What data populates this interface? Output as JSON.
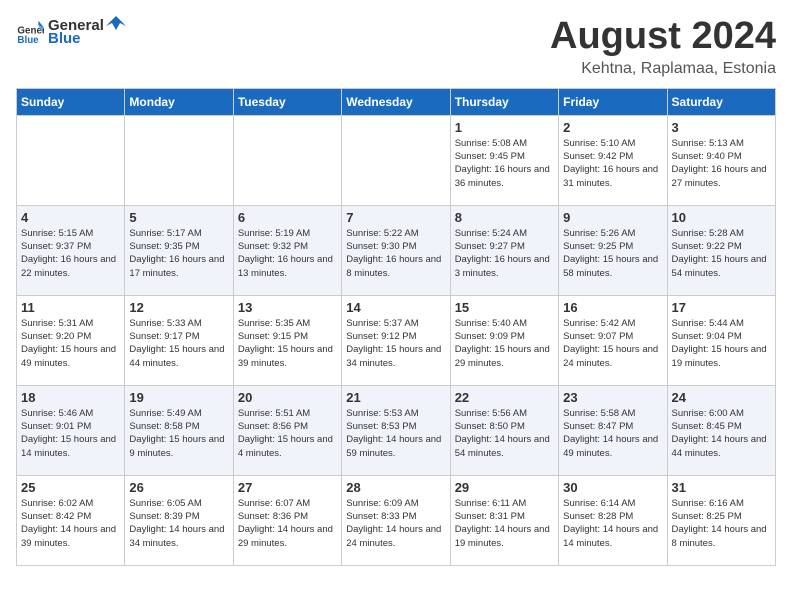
{
  "header": {
    "logo_general": "General",
    "logo_blue": "Blue",
    "title": "August 2024",
    "subtitle": "Kehtna, Raplamaa, Estonia"
  },
  "weekdays": [
    "Sunday",
    "Monday",
    "Tuesday",
    "Wednesday",
    "Thursday",
    "Friday",
    "Saturday"
  ],
  "weeks": [
    [
      {
        "day": "",
        "empty": true
      },
      {
        "day": "",
        "empty": true
      },
      {
        "day": "",
        "empty": true
      },
      {
        "day": "",
        "empty": true
      },
      {
        "day": "1",
        "sunrise": "5:08 AM",
        "sunset": "9:45 PM",
        "daylight": "16 hours and 36 minutes."
      },
      {
        "day": "2",
        "sunrise": "5:10 AM",
        "sunset": "9:42 PM",
        "daylight": "16 hours and 31 minutes."
      },
      {
        "day": "3",
        "sunrise": "5:13 AM",
        "sunset": "9:40 PM",
        "daylight": "16 hours and 27 minutes."
      }
    ],
    [
      {
        "day": "4",
        "sunrise": "5:15 AM",
        "sunset": "9:37 PM",
        "daylight": "16 hours and 22 minutes."
      },
      {
        "day": "5",
        "sunrise": "5:17 AM",
        "sunset": "9:35 PM",
        "daylight": "16 hours and 17 minutes."
      },
      {
        "day": "6",
        "sunrise": "5:19 AM",
        "sunset": "9:32 PM",
        "daylight": "16 hours and 13 minutes."
      },
      {
        "day": "7",
        "sunrise": "5:22 AM",
        "sunset": "9:30 PM",
        "daylight": "16 hours and 8 minutes."
      },
      {
        "day": "8",
        "sunrise": "5:24 AM",
        "sunset": "9:27 PM",
        "daylight": "16 hours and 3 minutes."
      },
      {
        "day": "9",
        "sunrise": "5:26 AM",
        "sunset": "9:25 PM",
        "daylight": "15 hours and 58 minutes."
      },
      {
        "day": "10",
        "sunrise": "5:28 AM",
        "sunset": "9:22 PM",
        "daylight": "15 hours and 54 minutes."
      }
    ],
    [
      {
        "day": "11",
        "sunrise": "5:31 AM",
        "sunset": "9:20 PM",
        "daylight": "15 hours and 49 minutes."
      },
      {
        "day": "12",
        "sunrise": "5:33 AM",
        "sunset": "9:17 PM",
        "daylight": "15 hours and 44 minutes."
      },
      {
        "day": "13",
        "sunrise": "5:35 AM",
        "sunset": "9:15 PM",
        "daylight": "15 hours and 39 minutes."
      },
      {
        "day": "14",
        "sunrise": "5:37 AM",
        "sunset": "9:12 PM",
        "daylight": "15 hours and 34 minutes."
      },
      {
        "day": "15",
        "sunrise": "5:40 AM",
        "sunset": "9:09 PM",
        "daylight": "15 hours and 29 minutes."
      },
      {
        "day": "16",
        "sunrise": "5:42 AM",
        "sunset": "9:07 PM",
        "daylight": "15 hours and 24 minutes."
      },
      {
        "day": "17",
        "sunrise": "5:44 AM",
        "sunset": "9:04 PM",
        "daylight": "15 hours and 19 minutes."
      }
    ],
    [
      {
        "day": "18",
        "sunrise": "5:46 AM",
        "sunset": "9:01 PM",
        "daylight": "15 hours and 14 minutes."
      },
      {
        "day": "19",
        "sunrise": "5:49 AM",
        "sunset": "8:58 PM",
        "daylight": "15 hours and 9 minutes."
      },
      {
        "day": "20",
        "sunrise": "5:51 AM",
        "sunset": "8:56 PM",
        "daylight": "15 hours and 4 minutes."
      },
      {
        "day": "21",
        "sunrise": "5:53 AM",
        "sunset": "8:53 PM",
        "daylight": "14 hours and 59 minutes."
      },
      {
        "day": "22",
        "sunrise": "5:56 AM",
        "sunset": "8:50 PM",
        "daylight": "14 hours and 54 minutes."
      },
      {
        "day": "23",
        "sunrise": "5:58 AM",
        "sunset": "8:47 PM",
        "daylight": "14 hours and 49 minutes."
      },
      {
        "day": "24",
        "sunrise": "6:00 AM",
        "sunset": "8:45 PM",
        "daylight": "14 hours and 44 minutes."
      }
    ],
    [
      {
        "day": "25",
        "sunrise": "6:02 AM",
        "sunset": "8:42 PM",
        "daylight": "14 hours and 39 minutes."
      },
      {
        "day": "26",
        "sunrise": "6:05 AM",
        "sunset": "8:39 PM",
        "daylight": "14 hours and 34 minutes."
      },
      {
        "day": "27",
        "sunrise": "6:07 AM",
        "sunset": "8:36 PM",
        "daylight": "14 hours and 29 minutes."
      },
      {
        "day": "28",
        "sunrise": "6:09 AM",
        "sunset": "8:33 PM",
        "daylight": "14 hours and 24 minutes."
      },
      {
        "day": "29",
        "sunrise": "6:11 AM",
        "sunset": "8:31 PM",
        "daylight": "14 hours and 19 minutes."
      },
      {
        "day": "30",
        "sunrise": "6:14 AM",
        "sunset": "8:28 PM",
        "daylight": "14 hours and 14 minutes."
      },
      {
        "day": "31",
        "sunrise": "6:16 AM",
        "sunset": "8:25 PM",
        "daylight": "14 hours and 8 minutes."
      }
    ]
  ]
}
